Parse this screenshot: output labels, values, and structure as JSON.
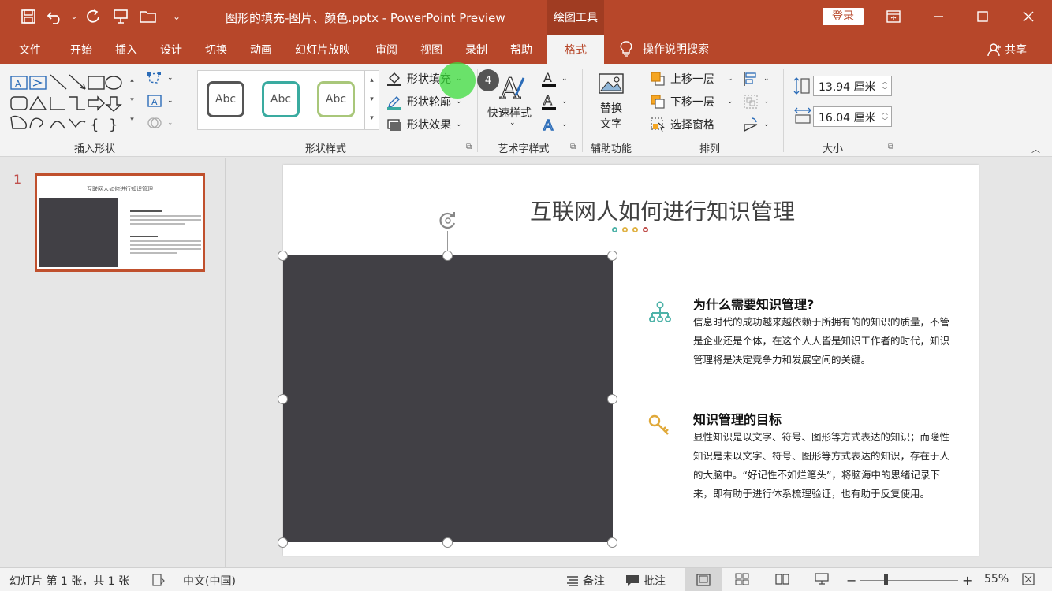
{
  "window": {
    "title": "图形的填充-图片、颜色.pptx  -  PowerPoint Preview",
    "context_tab": "绘图工具",
    "login": "登录",
    "minimize_icon": "minimize-icon",
    "maximize_icon": "maximize-icon",
    "close_icon": "close-icon"
  },
  "tabs": [
    {
      "label": "文件"
    },
    {
      "label": "开始"
    },
    {
      "label": "插入"
    },
    {
      "label": "设计"
    },
    {
      "label": "切换"
    },
    {
      "label": "动画"
    },
    {
      "label": "幻灯片放映"
    },
    {
      "label": "审阅"
    },
    {
      "label": "视图"
    },
    {
      "label": "录制"
    },
    {
      "label": "帮助"
    }
  ],
  "active_tab": "格式",
  "tell_me": "操作说明搜索",
  "share": "共享",
  "ribbon": {
    "groups": {
      "insert_shapes": "插入形状",
      "shape_styles": "形状样式",
      "wordart_styles": "艺术字样式",
      "accessibility": "辅助功能",
      "arrange": "排列",
      "size": "大小"
    },
    "style_samples": [
      "Abc",
      "Abc",
      "Abc"
    ],
    "shape_fill": "形状填充",
    "shape_outline": "形状轮廓",
    "shape_effects": "形状效果",
    "quick_styles": "快速样式",
    "alt_text_line1": "替换",
    "alt_text_line2": "文字",
    "bring_forward": "上移一层",
    "send_backward": "下移一层",
    "selection_pane": "选择窗格",
    "height_value": "13.94 厘米",
    "width_value": "16.04 厘米"
  },
  "cursor_step": "4",
  "thumbnail": {
    "number": "1",
    "title": "互联网人如何进行知识管理"
  },
  "slide": {
    "title": "互联网人如何进行知识管理",
    "dot_colors": [
      "#4fb3a9",
      "#e0b347",
      "#e0b347",
      "#c0504d"
    ],
    "section1": {
      "heading": "为什么需要知识管理?",
      "body": "信息时代的成功越来越依赖于所拥有的的知识的质量，不管是企业还是个体，在这个人人皆是知识工作者的时代，知识管理将是决定竞争力和发展空间的关键。"
    },
    "section2": {
      "heading": "知识管理的目标",
      "body": "显性知识是以文字、符号、图形等方式表达的知识；而隐性知识是未以文字、符号、图形等方式表达的知识，存在于人的大脑中。“好记性不如烂笔头”，将脑海中的思绪记录下来，即有助于进行体系梳理验证，也有助于反复使用。"
    }
  },
  "status": {
    "slide_info": "幻灯片 第 1 张，共 1 张",
    "language": "中文(中国)",
    "notes": "备注",
    "comments": "批注",
    "zoom": "55%"
  },
  "colors": {
    "accent": "#b7472a",
    "shape_fill": "#414045",
    "teal": "#4fb3a9",
    "gold": "#e0a93a"
  }
}
